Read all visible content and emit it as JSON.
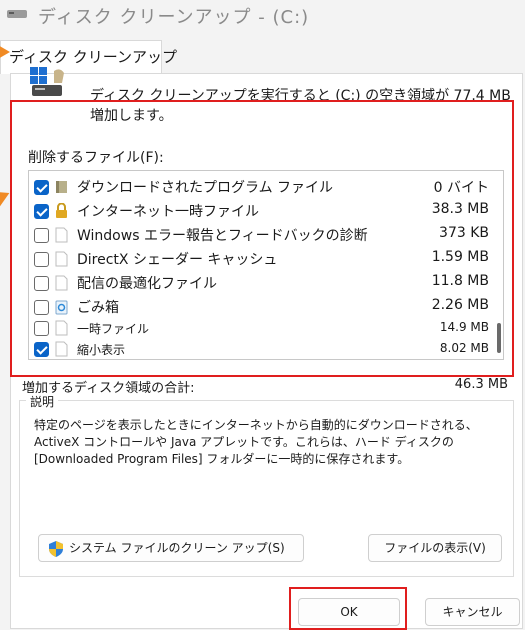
{
  "window": {
    "title": "ディスク クリーンアップ - (C:)"
  },
  "tab": {
    "label": "ディスク クリーンアップ"
  },
  "intro": {
    "text": "ディスク クリーンアップを実行すると (C:) の空き領域が 77.4 MB 増加します。"
  },
  "files_to_delete": {
    "label": "削除するファイル(F):",
    "items": [
      {
        "name": "ダウンロードされたプログラム ファイル",
        "size": "0 バイト",
        "checked": true,
        "icon": "folder-icon"
      },
      {
        "name": "インターネット一時ファイル",
        "size": "38.3 MB",
        "checked": true,
        "icon": "lock-icon"
      },
      {
        "name": "Windows エラー報告とフィードバックの診断",
        "size": "373 KB",
        "checked": false,
        "icon": "file-icon"
      },
      {
        "name": "DirectX シェーダー キャッシュ",
        "size": "1.59 MB",
        "checked": false,
        "icon": "file-icon"
      },
      {
        "name": "配信の最適化ファイル",
        "size": "11.8 MB",
        "checked": false,
        "icon": "file-icon"
      },
      {
        "name": "ごみ箱",
        "size": "2.26 MB",
        "checked": false,
        "icon": "recycle-bin-icon"
      },
      {
        "name": "一時ファイル",
        "size": "14.9 MB",
        "checked": false,
        "icon": "file-icon"
      },
      {
        "name": "縮小表示",
        "size": "8.02 MB",
        "checked": true,
        "icon": "file-icon"
      }
    ]
  },
  "total": {
    "label": "増加するディスク領域の合計:",
    "value": "46.3 MB"
  },
  "description": {
    "legend": "説明",
    "text": "特定のページを表示したときにインターネットから自動的にダウンロードされる、ActiveX コントロールや Java アプレットです。これらは、ハード ディスクの [Downloaded Program Files] フォルダーに一時的に保存されます。"
  },
  "buttons": {
    "system_cleanup": "システム ファイルのクリーン アップ(S)",
    "view_files": "ファイルの表示(V)",
    "ok": "OK",
    "cancel": "キャンセル"
  },
  "colors": {
    "accent": "#0a64c8",
    "highlight": "#e01e1e",
    "annotation_arrow": "#f08a24"
  }
}
